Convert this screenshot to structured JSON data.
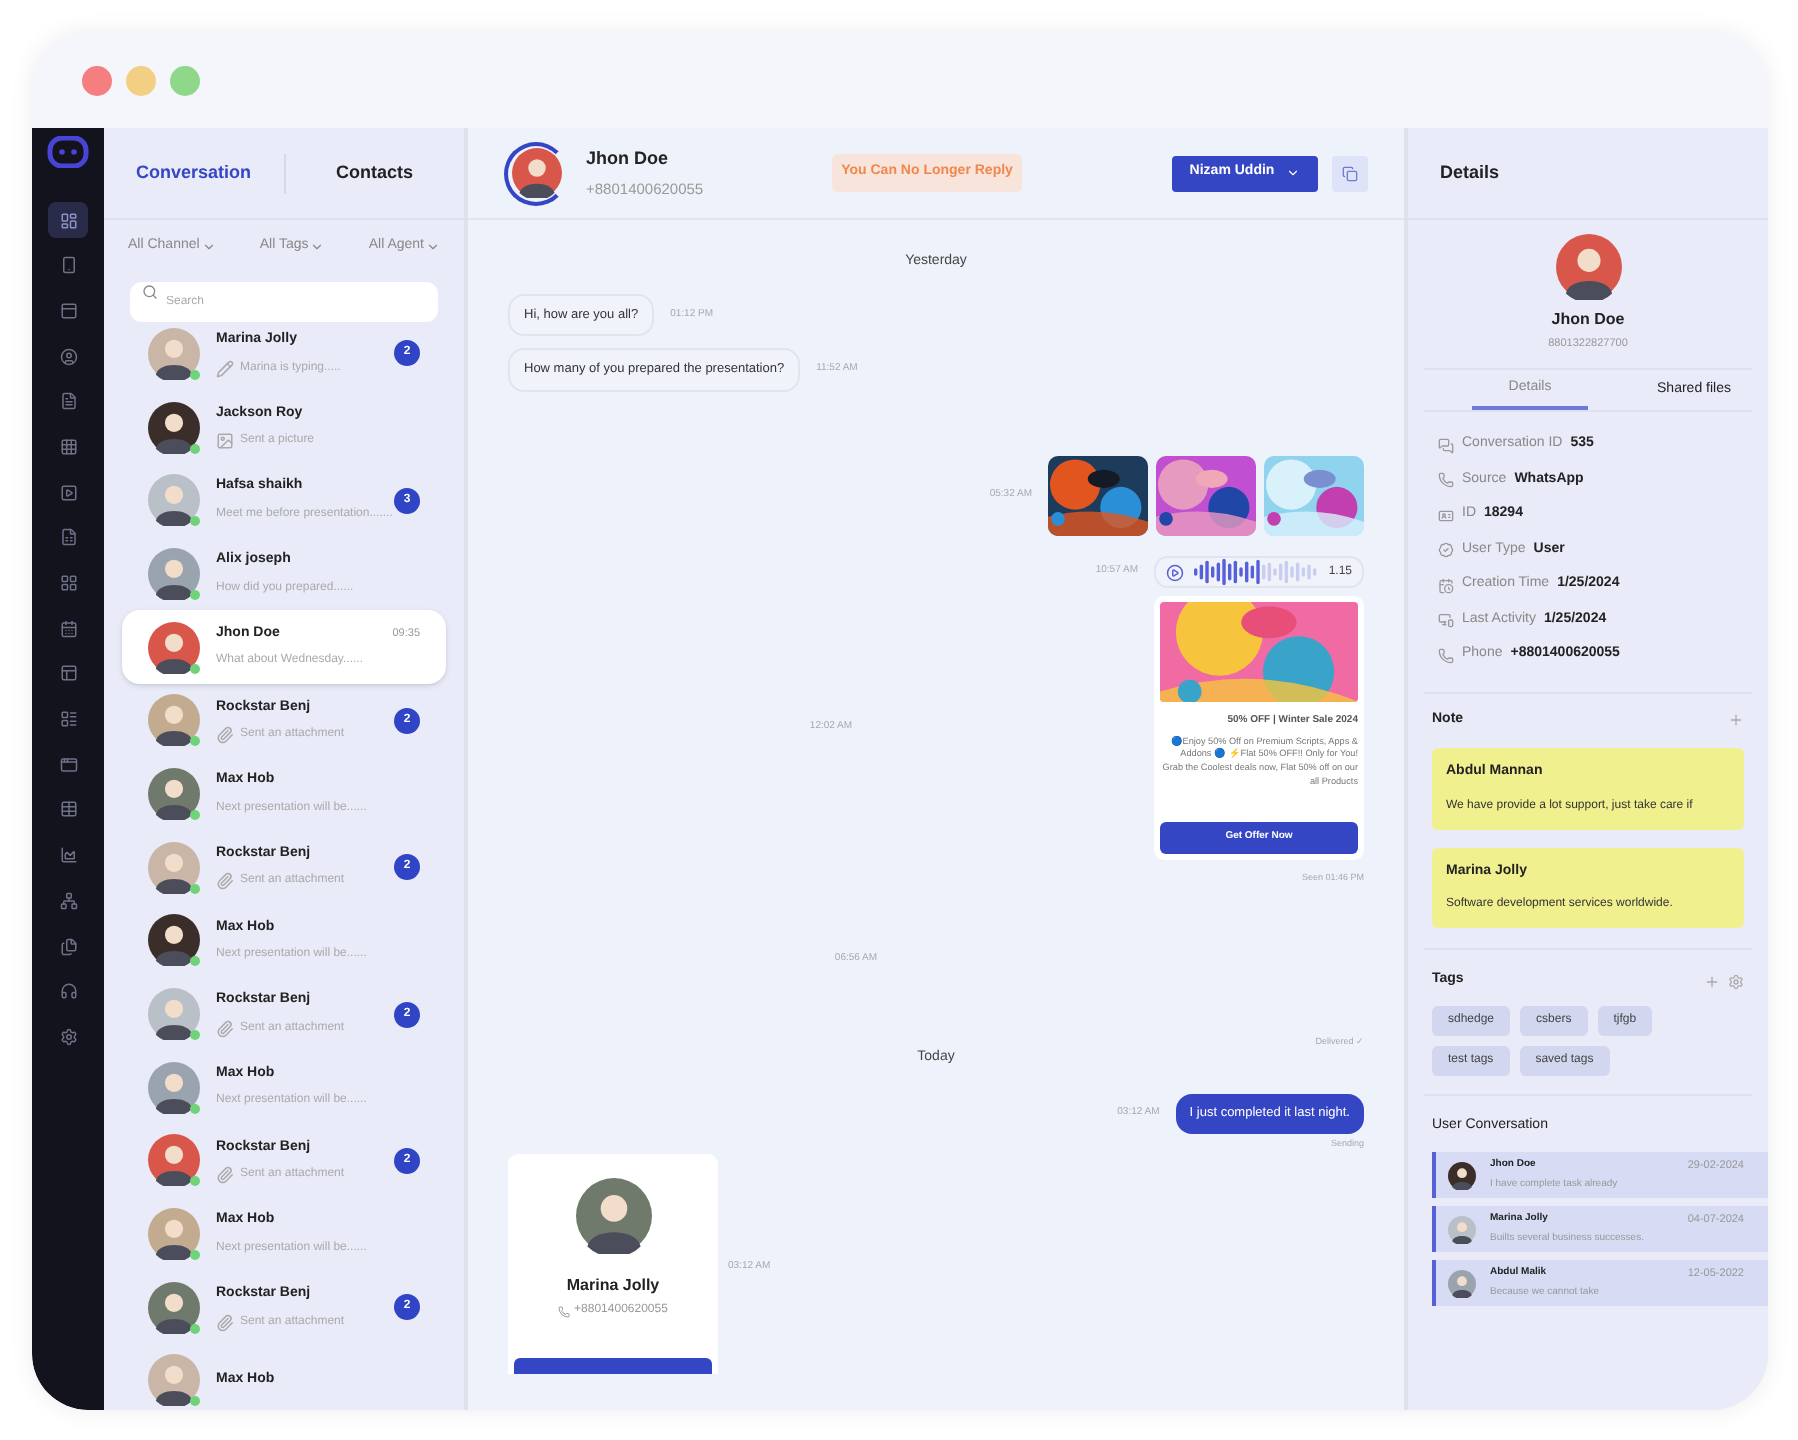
{
  "sidebar": {
    "items": [
      {
        "selected": true
      },
      {
        "selected": false
      },
      {
        "selected": false
      },
      {
        "selected": false
      },
      {
        "selected": false
      },
      {
        "selected": false
      },
      {
        "selected": false
      },
      {
        "selected": false
      },
      {
        "selected": false
      },
      {
        "selected": false
      },
      {
        "selected": false
      },
      {
        "selected": false
      },
      {
        "selected": false
      },
      {
        "selected": false
      },
      {
        "selected": false
      },
      {
        "selected": false
      },
      {
        "selected": false
      },
      {
        "selected": false
      },
      {
        "selected": false
      }
    ]
  },
  "list_tabs": [
    {
      "label": "Conversation",
      "selected": true
    },
    {
      "label": "Contacts",
      "selected": false
    }
  ],
  "filters": [
    "All Channel",
    "All Tags",
    "All Agent"
  ],
  "search": {
    "placeholder": "Search"
  },
  "contacts": [
    {
      "name": "Marina Jolly",
      "preview": "Marina is typing.....",
      "kind": "typing",
      "badge": "2",
      "online": true,
      "selected": false
    },
    {
      "name": "Jackson Roy",
      "preview": "Sent a picture",
      "kind": "picture",
      "online": true,
      "selected": false
    },
    {
      "name": "Hafsa shaikh",
      "preview": "Meet me before presentation.......",
      "kind": "text",
      "badge": "3",
      "online": true,
      "selected": false
    },
    {
      "name": "Alix joseph",
      "preview": "How did you prepared......",
      "kind": "text",
      "online": true,
      "selected": false
    },
    {
      "name": "Jhon Doe",
      "preview": "What about Wednesday......",
      "kind": "text",
      "time": "09:35",
      "online": true,
      "selected": true
    },
    {
      "name": "Rockstar Benj",
      "preview": "Sent an attachment",
      "kind": "attachment",
      "badge": "2",
      "online": true,
      "selected": false
    },
    {
      "name": "Max Hob",
      "preview": "Next presentation will be......",
      "kind": "text",
      "online": true,
      "selected": false
    },
    {
      "name": "Rockstar Benj",
      "preview": "Sent an attachment",
      "kind": "attachment",
      "badge": "2",
      "online": true,
      "selected": false
    },
    {
      "name": "Max Hob",
      "preview": "Next presentation will be......",
      "kind": "text",
      "online": true,
      "selected": false
    },
    {
      "name": "Rockstar Benj",
      "preview": "Sent an attachment",
      "kind": "attachment",
      "badge": "2",
      "online": true,
      "selected": false
    },
    {
      "name": "Max Hob",
      "preview": "Next presentation will be......",
      "kind": "text",
      "online": true,
      "selected": false
    },
    {
      "name": "Rockstar Benj",
      "preview": "Sent an attachment",
      "kind": "attachment",
      "badge": "2",
      "online": true,
      "selected": false
    },
    {
      "name": "Max Hob",
      "preview": "Next presentation will be......",
      "kind": "text",
      "online": true,
      "selected": false
    },
    {
      "name": "Rockstar Benj",
      "preview": "Sent an attachment",
      "kind": "attachment",
      "badge": "2",
      "online": true,
      "selected": false
    },
    {
      "name": "Max Hob",
      "online": true,
      "selected": false
    }
  ],
  "chat_header": {
    "name": "Jhon Doe",
    "phone": "+8801400620055",
    "notice": "You Can No Longer Reply",
    "agent": "Nizam Uddin"
  },
  "messages": [
    {
      "kind": "divider",
      "text": "Yesterday"
    },
    {
      "kind": "text",
      "outgoing": false,
      "text": "Hi, how are you all?",
      "time": "01:12 PM"
    },
    {
      "kind": "text",
      "outgoing": false,
      "text": "How many of you prepared the presentation?",
      "time": "11:52 AM"
    },
    {
      "kind": "images",
      "time": "05:32 AM"
    },
    {
      "kind": "audio",
      "time": "10:57 AM",
      "duration": "1.15",
      "level": 0.55
    },
    {
      "kind": "offer",
      "time": "12:02 AM",
      "title": "50% OFF | Winter Sale 2024",
      "text": "🔵Enjoy 50% Off on Premium Scripts, Apps & Addons 🔵 ⚡Flat 50% OFF!! Only for You! Grab the Coolest deals now, Flat 50% off on our all Products",
      "button": "Get Offer Now",
      "status": "Seen 01:46 PM"
    },
    {
      "kind": "blank",
      "time": "06:56 AM",
      "status": "Delivered ✓"
    },
    {
      "kind": "divider",
      "text": "Today"
    },
    {
      "kind": "text",
      "outgoing": true,
      "text": "I just completed it last night.",
      "time": "03:12 AM",
      "status": "Sending"
    },
    {
      "kind": "contact",
      "name": "Marina Jolly",
      "phone": "+8801400620055",
      "time": "03:12 AM"
    }
  ],
  "details": {
    "title": "Details",
    "name": "Jhon Doe",
    "phone": "8801322827700",
    "tabs": [
      {
        "label": "Details",
        "selected": true
      },
      {
        "label": "Shared files",
        "selected": false
      }
    ],
    "fields": [
      {
        "label": "Conversation ID",
        "value": "535"
      },
      {
        "label": "Source",
        "value": "WhatsApp"
      },
      {
        "label": "ID",
        "value": "18294"
      },
      {
        "label": "User Type",
        "value": "User"
      },
      {
        "label": "Creation Time",
        "value": "1/25/2024"
      },
      {
        "label": "Last Activity",
        "value": "1/25/2024"
      },
      {
        "label": "Phone",
        "value": "+8801400620055"
      }
    ],
    "note_title": "Note",
    "notes": [
      {
        "author": "Abdul Mannan",
        "text": "We have provide a lot support, just take care if"
      },
      {
        "author": "Marina Jolly",
        "text": "Software development services worldwide."
      }
    ],
    "tags_title": "Tags",
    "tags": [
      "sdhedge",
      "csbers",
      "tjfgb",
      "test tags",
      "saved tags"
    ],
    "conversations_title": "User Conversation",
    "conversations": [
      {
        "name": "Jhon Doe",
        "date": "29-02-2024",
        "text": "I have complete task already"
      },
      {
        "name": "Marina Jolly",
        "date": "04-07-2024",
        "text": "Builts several business successes."
      },
      {
        "name": "Abdul Malik",
        "date": "12-05-2022",
        "text": "Because we cannot take"
      }
    ]
  }
}
